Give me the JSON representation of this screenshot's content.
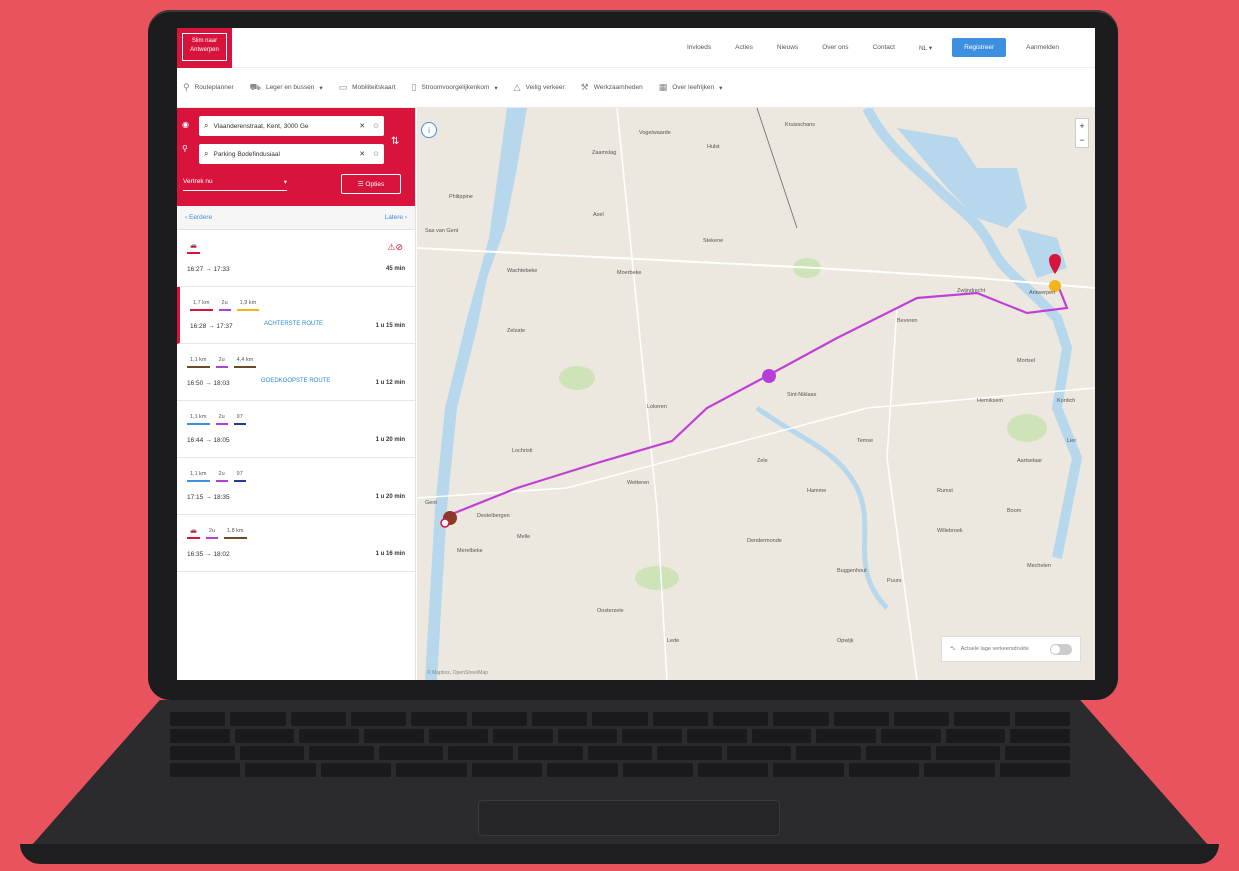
{
  "brand": {
    "logo_line1": "Slim naar",
    "logo_line2": "Antwerpen",
    "accent": "#d9143c",
    "blue": "#3d8fe0"
  },
  "topnav": {
    "items": [
      "Invloeds",
      "Acties",
      "Nieuws",
      "Over ons",
      "Contact"
    ],
    "language": "NL",
    "register": "Registreer",
    "login": "Aanmelden"
  },
  "subnav": {
    "items": [
      {
        "label": "Routeplanner",
        "icon": "pin-icon"
      },
      {
        "label": "Leger en bussen",
        "icon": "bus-icon"
      },
      {
        "label": "Mobiliteitskaart",
        "icon": "map-icon"
      },
      {
        "label": "Stroomvoorgelijkenkom",
        "icon": "doc-icon"
      },
      {
        "label": "Veilig verkeer",
        "icon": "warning-icon"
      },
      {
        "label": "Werkzaamheden",
        "icon": "construction-icon"
      },
      {
        "label": "Over leefrijken",
        "icon": "grid-icon"
      }
    ]
  },
  "search": {
    "from": "Vlaanderenstraat, Kent, 3000 Ge",
    "to": "Parking Bodefindusiaal",
    "depart": "Vertrek nu",
    "options": "Opties"
  },
  "results": {
    "earlier": "Eerdere",
    "later": "Latere",
    "trips": [
      {
        "modes": [
          "car"
        ],
        "times": "16:27 → 17:33",
        "duration": "45 min",
        "note": ""
      },
      {
        "modes": [
          "1,7 km",
          "2u",
          "1,9 km"
        ],
        "times": "16:28 → 17:37",
        "duration": "1 u 15 min",
        "note": "ACHTERSTE ROUTE"
      },
      {
        "modes": [
          "1,1 km",
          "2u",
          "4,4 km"
        ],
        "times": "16:50 → 18:03",
        "duration": "1 u 12 min",
        "note": "GOEDKOOPSTE ROUTE"
      },
      {
        "modes": [
          "1,1 km",
          "2u",
          "97"
        ],
        "times": "16:44 → 18:05",
        "duration": "1 u 20 min",
        "note": ""
      },
      {
        "modes": [
          "1,1 km",
          "2u",
          "97"
        ],
        "times": "17:15 → 18:35",
        "duration": "1 u 20 min",
        "note": ""
      },
      {
        "modes": [
          "car",
          "2u",
          "1,8 km"
        ],
        "times": "16:35 → 18:02",
        "duration": "1 u 16 min",
        "note": ""
      }
    ]
  },
  "map": {
    "towns": [
      "Kruisschans",
      "Vogelwaarde",
      "Zaamslag",
      "Hulst",
      "Philippine",
      "Stekene",
      "Axel",
      "Sas van Gent",
      "Moerbeke",
      "Wachtebeke",
      "Zelzate",
      "Lochristi",
      "Sint-Niklaas",
      "Temse",
      "Beveren",
      "Zwijndrecht",
      "Antwerpen",
      "Lokeren",
      "Wetteren",
      "Gent",
      "Dendermonde",
      "Zele",
      "Hamme",
      "Merelbeke",
      "Melle",
      "Oosterzele",
      "Boom",
      "Mechelen",
      "Willebroek",
      "Puurs",
      "Lier",
      "Kontich",
      "Mortsel",
      "Hemiksem",
      "Aartselaar",
      "Rumst",
      "Buggenhout",
      "Opwijk",
      "Lede",
      "Destelbergen"
    ],
    "toggle_label": "Actuele lage verkeersdrukte",
    "attrib": "© Mapbox, OpenStreetMap"
  }
}
